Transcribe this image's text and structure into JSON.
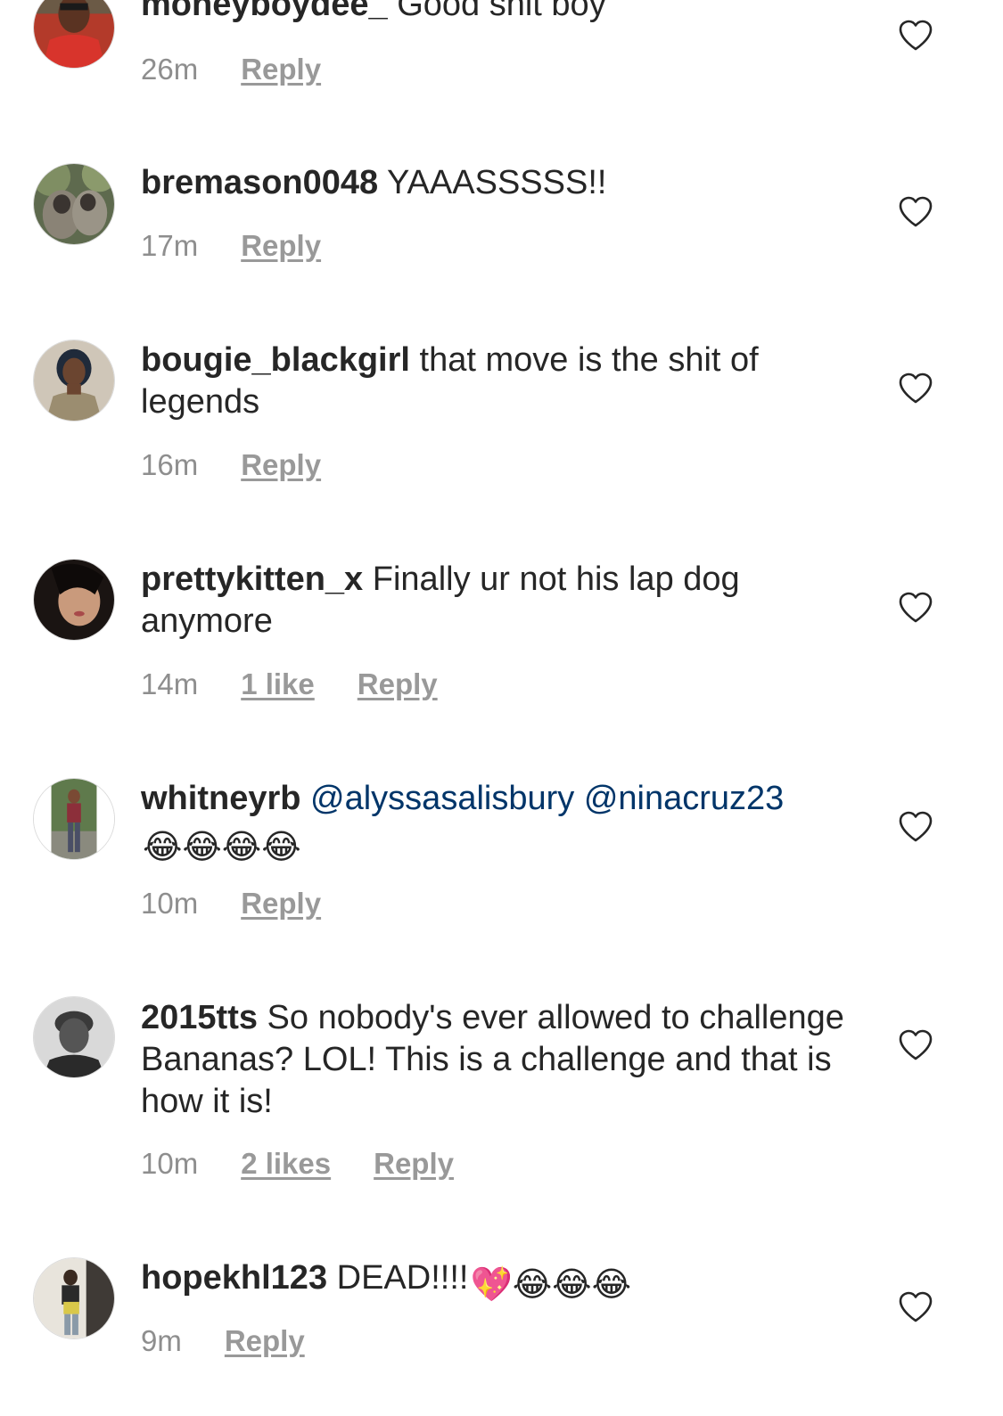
{
  "comments": [
    {
      "username": "moneyboydee_",
      "text": "Good shit boy",
      "time": "26m",
      "reply_label": "Reply",
      "avatar_icon": "avatar-red-outfit-photo",
      "heart_icon": "heart-outline-icon"
    },
    {
      "username": "bremason0048",
      "text": "YAAASSSSS!!",
      "time": "17m",
      "reply_label": "Reply",
      "avatar_icon": "avatar-two-monkeys-photo",
      "heart_icon": "heart-outline-icon"
    },
    {
      "username": "bougie_blackgirl",
      "text": "that move is the shit of legends",
      "time": "16m",
      "reply_label": "Reply",
      "avatar_icon": "avatar-woman-selfie-photo",
      "heart_icon": "heart-outline-icon"
    },
    {
      "username": "prettykitten_x",
      "text": "Finally ur not his lap dog anymore",
      "time": "14m",
      "likes": "1 like",
      "reply_label": "Reply",
      "avatar_icon": "avatar-woman-dark-hair-photo",
      "heart_icon": "heart-outline-icon"
    },
    {
      "username": "whitneyrb",
      "mention1": "@alyssasalisbury",
      "mention2": "@ninacruz23",
      "emoji": "😂😂😂😂",
      "time": "10m",
      "reply_label": "Reply",
      "avatar_icon": "avatar-woman-standing-photo",
      "heart_icon": "heart-outline-icon"
    },
    {
      "username": "2015tts",
      "text": "So nobody's ever allowed to challenge Bananas? LOL! This is a challenge and that is how it is!",
      "time": "10m",
      "likes": "2 likes",
      "reply_label": "Reply",
      "avatar_icon": "avatar-grayscale-woman-photo",
      "heart_icon": "heart-outline-icon"
    },
    {
      "username": "hopekhl123",
      "text": "DEAD!!!!",
      "emoji": "💖😂😂😂",
      "time": "9m",
      "reply_label": "Reply",
      "avatar_icon": "avatar-person-room-photo",
      "heart_icon": "heart-outline-icon"
    }
  ],
  "colors": {
    "text": "#262626",
    "meta": "#8e8e8e",
    "mention": "#003569",
    "heart_stroke": "#262626"
  }
}
